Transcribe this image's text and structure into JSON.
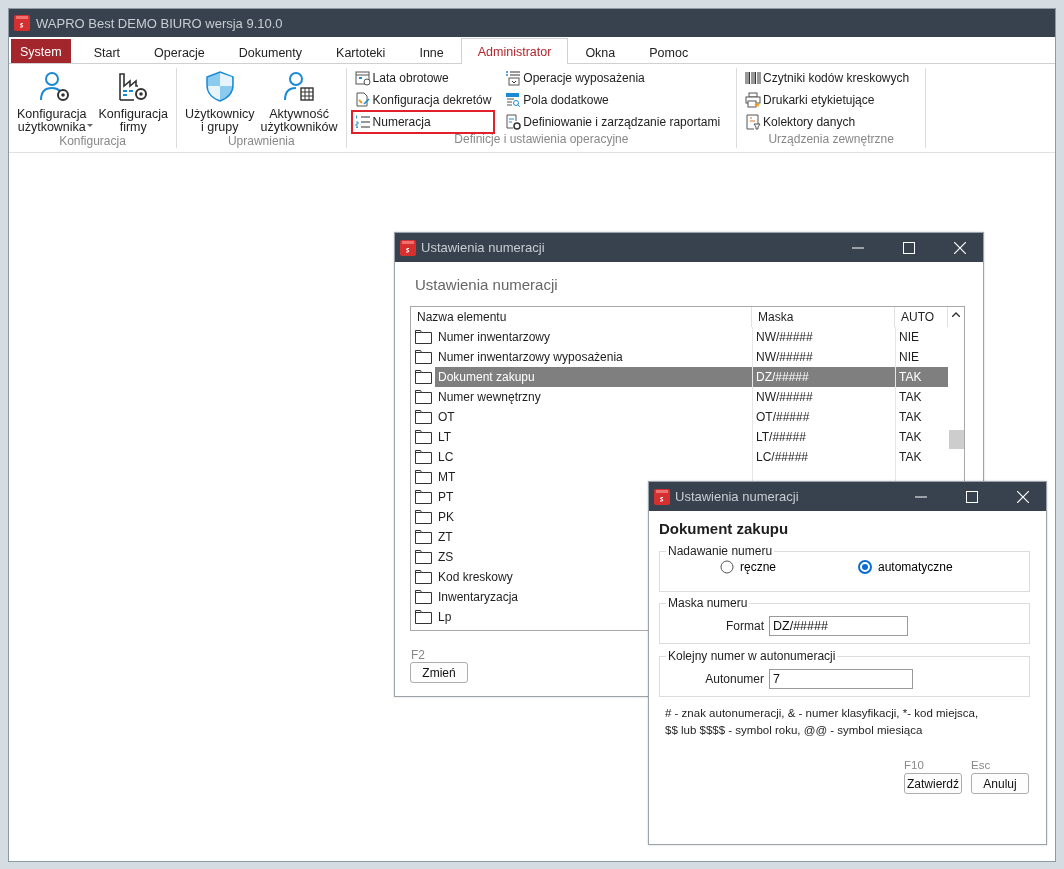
{
  "app_window": {
    "title": "WAPRO Best DEMO BIURO wersja 9.10.0"
  },
  "tabs": [
    {
      "label": "System",
      "kind": "app-menu",
      "selected": false
    },
    {
      "label": "Start",
      "kind": "tab",
      "selected": false
    },
    {
      "label": "Operacje",
      "kind": "tab",
      "selected": false
    },
    {
      "label": "Dokumenty",
      "kind": "tab",
      "selected": false
    },
    {
      "label": "Kartoteki",
      "kind": "tab",
      "selected": false
    },
    {
      "label": "Inne",
      "kind": "tab",
      "selected": false
    },
    {
      "label": "Administrator",
      "kind": "tab",
      "selected": true
    },
    {
      "label": "Okna",
      "kind": "tab",
      "selected": false
    },
    {
      "label": "Pomoc",
      "kind": "tab",
      "selected": false
    }
  ],
  "ribbon": {
    "groups": [
      {
        "label": "Konfiguracja",
        "kind": "large",
        "items": [
          {
            "lines": [
              "Konfiguracja",
              "użytkownika"
            ],
            "dropdown": true
          },
          {
            "lines": [
              "Konfiguracja",
              "firmy"
            ],
            "dropdown": false
          }
        ]
      },
      {
        "label": "Uprawnienia",
        "kind": "large",
        "items": [
          {
            "lines": [
              "Użytkownicy",
              "i grupy"
            ],
            "dropdown": false
          },
          {
            "lines": [
              "Aktywność",
              "użytkowników"
            ],
            "dropdown": false
          }
        ]
      },
      {
        "label": "Definicje i ustawienia operacyjne",
        "kind": "small",
        "columns": [
          [
            {
              "label": "Lata obrotowe",
              "highlighted": false
            },
            {
              "label": "Konfiguracja dekretów",
              "highlighted": false
            },
            {
              "label": "Numeracja",
              "highlighted": true
            }
          ],
          [
            {
              "label": "Operacje wyposażenia",
              "highlighted": false
            },
            {
              "label": "Pola dodatkowe",
              "highlighted": false
            },
            {
              "label": "Definiowanie i zarządzanie raportami",
              "highlighted": false
            }
          ]
        ]
      },
      {
        "label": "Urządzenia zewnętrzne",
        "kind": "small",
        "columns": [
          [
            {
              "label": "Czytniki kodów kreskowych",
              "highlighted": false
            },
            {
              "label": "Drukarki etykietujące",
              "highlighted": false
            },
            {
              "label": "Kolektory danych",
              "highlighted": false
            }
          ]
        ]
      }
    ]
  },
  "list_dialog": {
    "title": "Ustawienia numeracji",
    "heading": "Ustawienia numeracji",
    "table": {
      "columns": [
        "Nazwa elementu",
        "Maska",
        "AUTO"
      ],
      "rows": [
        {
          "name": "Numer inwentarzowy",
          "mask": "NW/#####",
          "auto": "NIE",
          "selected": false
        },
        {
          "name": "Numer inwentarzowy wyposażenia",
          "mask": "NW/#####",
          "auto": "NIE",
          "selected": false
        },
        {
          "name": "Dokument zakupu",
          "mask": "DZ/#####",
          "auto": "TAK",
          "selected": true
        },
        {
          "name": "Numer wewnętrzny",
          "mask": "NW/#####",
          "auto": "TAK",
          "selected": false
        },
        {
          "name": "OT",
          "mask": "OT/#####",
          "auto": "TAK",
          "selected": false
        },
        {
          "name": "LT",
          "mask": "LT/#####",
          "auto": "TAK",
          "selected": false
        },
        {
          "name": "LC",
          "mask": "LC/#####",
          "auto": "TAK",
          "selected": false
        },
        {
          "name": "MT",
          "selected": false
        },
        {
          "name": "PT",
          "selected": false
        },
        {
          "name": "PK",
          "selected": false
        },
        {
          "name": "ZT",
          "selected": false
        },
        {
          "name": "ZS",
          "selected": false
        },
        {
          "name": "Kod kreskowy",
          "selected": false
        },
        {
          "name": "Inwentaryzacja",
          "selected": false
        },
        {
          "name": "Lp",
          "selected": false
        }
      ]
    },
    "shortcut": "F2",
    "button": "Zmień"
  },
  "edit_dialog": {
    "title": "Ustawienia numeracji",
    "heading": "Dokument zakupu",
    "numbering": {
      "legend": "Nadawanie numeru",
      "options": [
        {
          "label": "ręczne",
          "selected": false
        },
        {
          "label": "automatyczne",
          "selected": true
        }
      ]
    },
    "mask": {
      "legend": "Maska numeru",
      "label": "Format",
      "value": "DZ/#####"
    },
    "counter": {
      "legend": "Kolejny numer w autonumeracji",
      "label": "Autonumer",
      "value": "7"
    },
    "notes": [
      "# - znak autonumeracji, & - numer klasyfikacji, *- kod miejsca,",
      "$$ lub $$$$ - symbol roku, @@ - symbol miesiąca"
    ],
    "buttons": [
      {
        "shortcut": "F10",
        "label": "Zatwierdź"
      },
      {
        "shortcut": "Esc",
        "label": "Anuluj"
      }
    ]
  }
}
